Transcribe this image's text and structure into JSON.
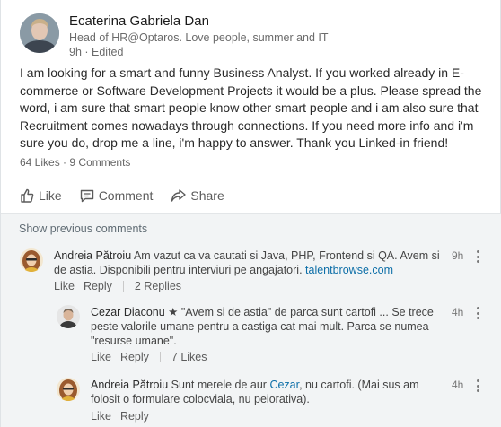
{
  "post": {
    "author": {
      "name": "Ecaterina Gabriela Dan",
      "headline": "Head of HR@Optaros. Love people, summer and IT",
      "meta": "9h · Edited"
    },
    "body": "I am looking for a smart and funny Business Analyst. If you worked already in E-commerce or Software Development Projects it would be a plus. Please spread the word, i am sure that smart people know other smart people and i am also sure that Recruitment comes nowadays through connections. If you need more info and i'm sure you do, drop me a line, i'm happy to answer. Thank you Linked-in friend!",
    "stats": {
      "likes": "64 Likes",
      "separator": "·",
      "comments": "9 Comments"
    },
    "actions": {
      "like": "Like",
      "comment": "Comment",
      "share": "Share"
    }
  },
  "comments": {
    "show_previous": "Show previous comments",
    "items": [
      {
        "author": "Andreia Pătroiu",
        "text": "Am vazut ca va cautati si Java, PHP, Frontend si QA. Avem si de astia. Disponibili pentru interviuri pe angajatori.",
        "link": "talentbrowse.com",
        "time": "9h",
        "like": "Like",
        "reply": "Reply",
        "replies_count": "2 Replies"
      }
    ],
    "replies": [
      {
        "author": "Cezar Diaconu",
        "badge": "★",
        "text": "\"Avem si de astia\" de parca sunt cartofi ... Se trece peste valorile umane pentru a castiga cat mai mult. Parca se numea \"resurse umane\".",
        "time": "4h",
        "like": "Like",
        "reply": "Reply",
        "likes_count": "7 Likes"
      },
      {
        "author": "Andreia Pătroiu",
        "text_before": "Sunt merele de aur",
        "mention": "Cezar",
        "text_after": ", nu cartofi. (Mai sus am folosit o formulare colocviala, nu peiorativa).",
        "time": "4h",
        "like": "Like",
        "reply": "Reply"
      }
    ]
  },
  "colors": {
    "link": "#0e6fa8",
    "comments_bg": "#f2f4f5"
  }
}
